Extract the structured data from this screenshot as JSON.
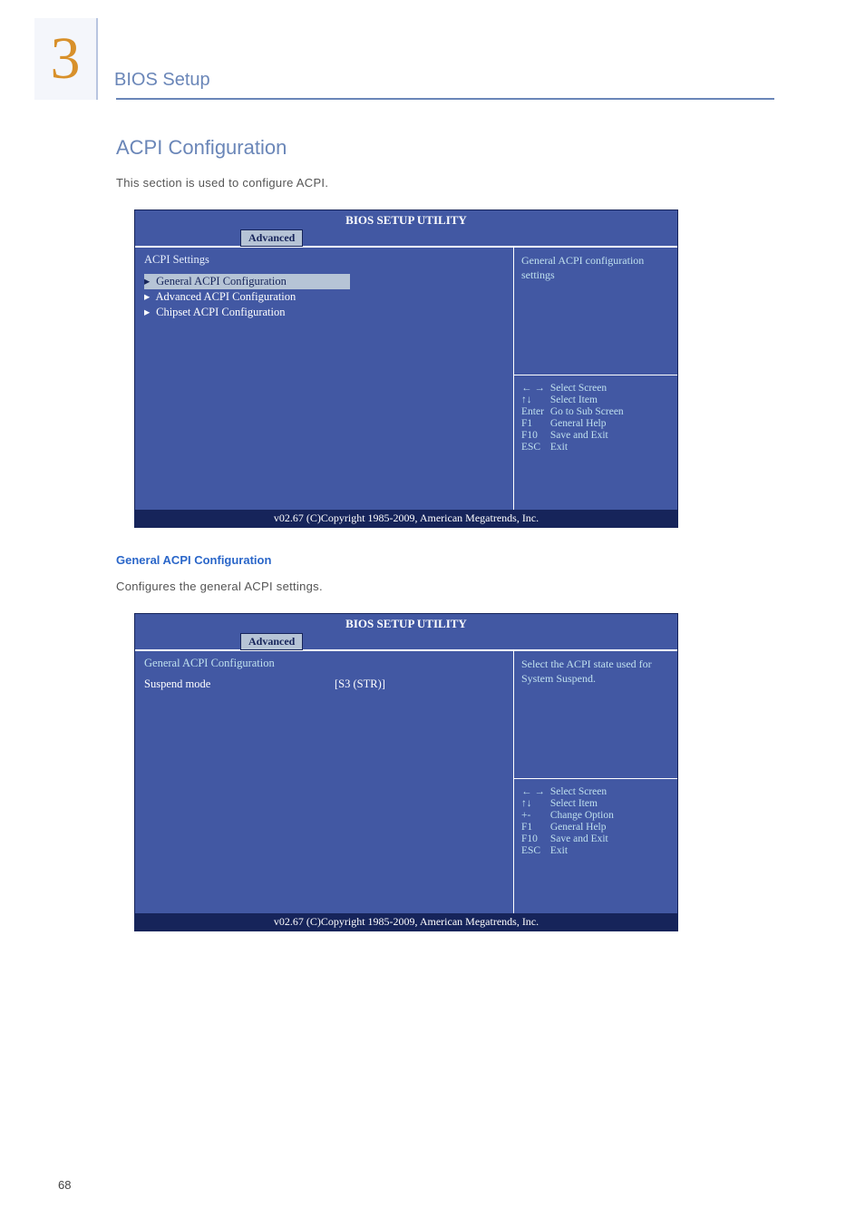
{
  "page": {
    "number": "68"
  },
  "chapter": {
    "number": "3",
    "title": "BIOS Setup"
  },
  "section": {
    "heading": "ACPI Configuration",
    "intro": "This section is used to configure ACPI.",
    "sub_heading": "General ACPI Configuration",
    "sub_intro": "Configures the general ACPI settings."
  },
  "bios1": {
    "title": "BIOS SETUP UTILITY",
    "tab": "Advanced",
    "heading": "ACPI Settings",
    "items": [
      "General ACPI Configuration",
      "Advanced ACPI Configuration",
      "Chipset ACPI Configuration"
    ],
    "help": "General ACPI configuration settings",
    "keys": [
      {
        "k": "← →",
        "d": "Select Screen"
      },
      {
        "k": "↑↓",
        "d": "Select Item"
      },
      {
        "k": "Enter",
        "d": "Go to Sub Screen"
      },
      {
        "k": "F1",
        "d": "General Help"
      },
      {
        "k": "F10",
        "d": "Save and Exit"
      },
      {
        "k": "ESC",
        "d": "Exit"
      }
    ],
    "footer": "v02.67 (C)Copyright 1985-2009, American Megatrends, Inc."
  },
  "bios2": {
    "title": "BIOS SETUP UTILITY",
    "tab": "Advanced",
    "heading": "General ACPI Configuration",
    "option_label": "Suspend mode",
    "option_value": "[S3 (STR)]",
    "help": "Select the ACPI state used for System Suspend.",
    "keys": [
      {
        "k": "← →",
        "d": "Select Screen"
      },
      {
        "k": "↑↓",
        "d": "Select Item"
      },
      {
        "k": "+-",
        "d": "Change Option"
      },
      {
        "k": "F1",
        "d": "General Help"
      },
      {
        "k": "F10",
        "d": "Save and Exit"
      },
      {
        "k": "ESC",
        "d": "Exit"
      }
    ],
    "footer": "v02.67 (C)Copyright 1985-2009, American Megatrends, Inc."
  }
}
